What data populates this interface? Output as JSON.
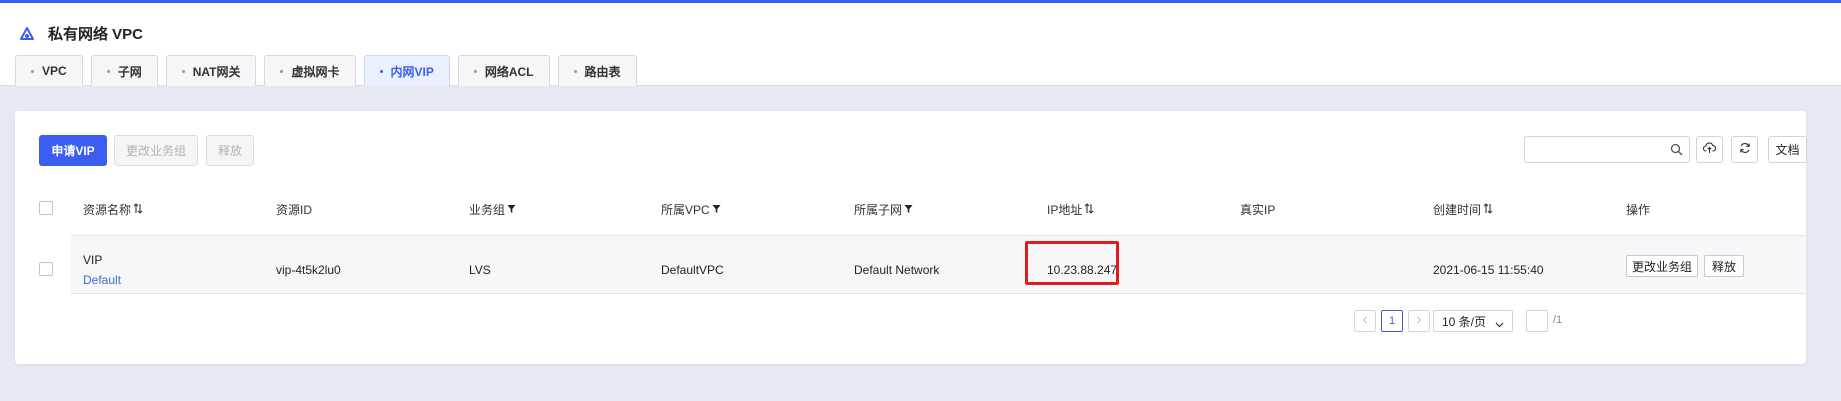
{
  "header": {
    "title": "私有网络 VPC"
  },
  "tabs": [
    {
      "label": "VPC",
      "active": false
    },
    {
      "label": "子网",
      "active": false
    },
    {
      "label": "NAT网关",
      "active": false
    },
    {
      "label": "虚拟网卡",
      "active": false
    },
    {
      "label": "内网VIP",
      "active": true
    },
    {
      "label": "网络ACL",
      "active": false
    },
    {
      "label": "路由表",
      "active": false
    }
  ],
  "toolbar": {
    "apply_label": "申请VIP",
    "change_group_label": "更改业务组",
    "release_label": "释放",
    "search_placeholder": "",
    "search_icon": "search-icon",
    "upload_icon": "cloud-upload-icon",
    "refresh_icon": "refresh-icon",
    "docs_label": "文档"
  },
  "table": {
    "columns": [
      {
        "label": "资源名称",
        "marker": "sort"
      },
      {
        "label": "资源ID",
        "marker": ""
      },
      {
        "label": "业务组",
        "marker": "filter"
      },
      {
        "label": "所属VPC",
        "marker": "filter"
      },
      {
        "label": "所属子网",
        "marker": "filter"
      },
      {
        "label": "IP地址",
        "marker": "sort"
      },
      {
        "label": "真实IP",
        "marker": ""
      },
      {
        "label": "创建时间",
        "marker": "sort"
      },
      {
        "label": "操作",
        "marker": ""
      }
    ],
    "rows": [
      {
        "name": "VIP",
        "name_sub": "Default",
        "resource_id": "vip-4t5k2lu0",
        "business_group": "LVS",
        "vpc": "DefaultVPC",
        "subnet": "Default Network",
        "ip": "10.23.88.247",
        "real_ip": "",
        "created": "2021-06-15 11:55:40",
        "actions": [
          "更改业务组",
          "释放"
        ]
      }
    ]
  },
  "pagination": {
    "current_page": "1",
    "page_size": "10 条/页",
    "jump_value": "",
    "total_pages": "/1"
  },
  "colors": {
    "accent": "#3c5df2",
    "highlight": "#e31b1b"
  }
}
